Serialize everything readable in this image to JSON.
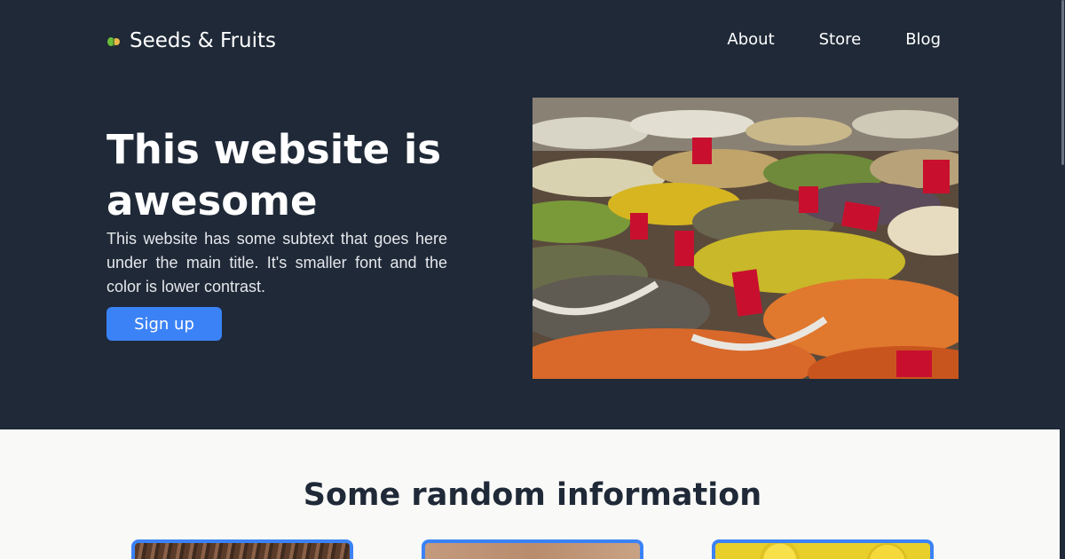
{
  "brand": {
    "name": "Seeds & Fruits",
    "icon": "seedling-icon"
  },
  "nav": {
    "items": [
      {
        "label": "About"
      },
      {
        "label": "Store"
      },
      {
        "label": "Blog"
      }
    ]
  },
  "hero": {
    "title": "This website is awesome",
    "subtext": "This website has some subtext that goes here under the main title. It's smaller font and the color is lower contrast.",
    "cta_label": "Sign up"
  },
  "section": {
    "title": "Some random information"
  },
  "colors": {
    "hero_bg": "#1f2937",
    "accent": "#3b82f6",
    "page_bg": "#f9f9f7"
  }
}
